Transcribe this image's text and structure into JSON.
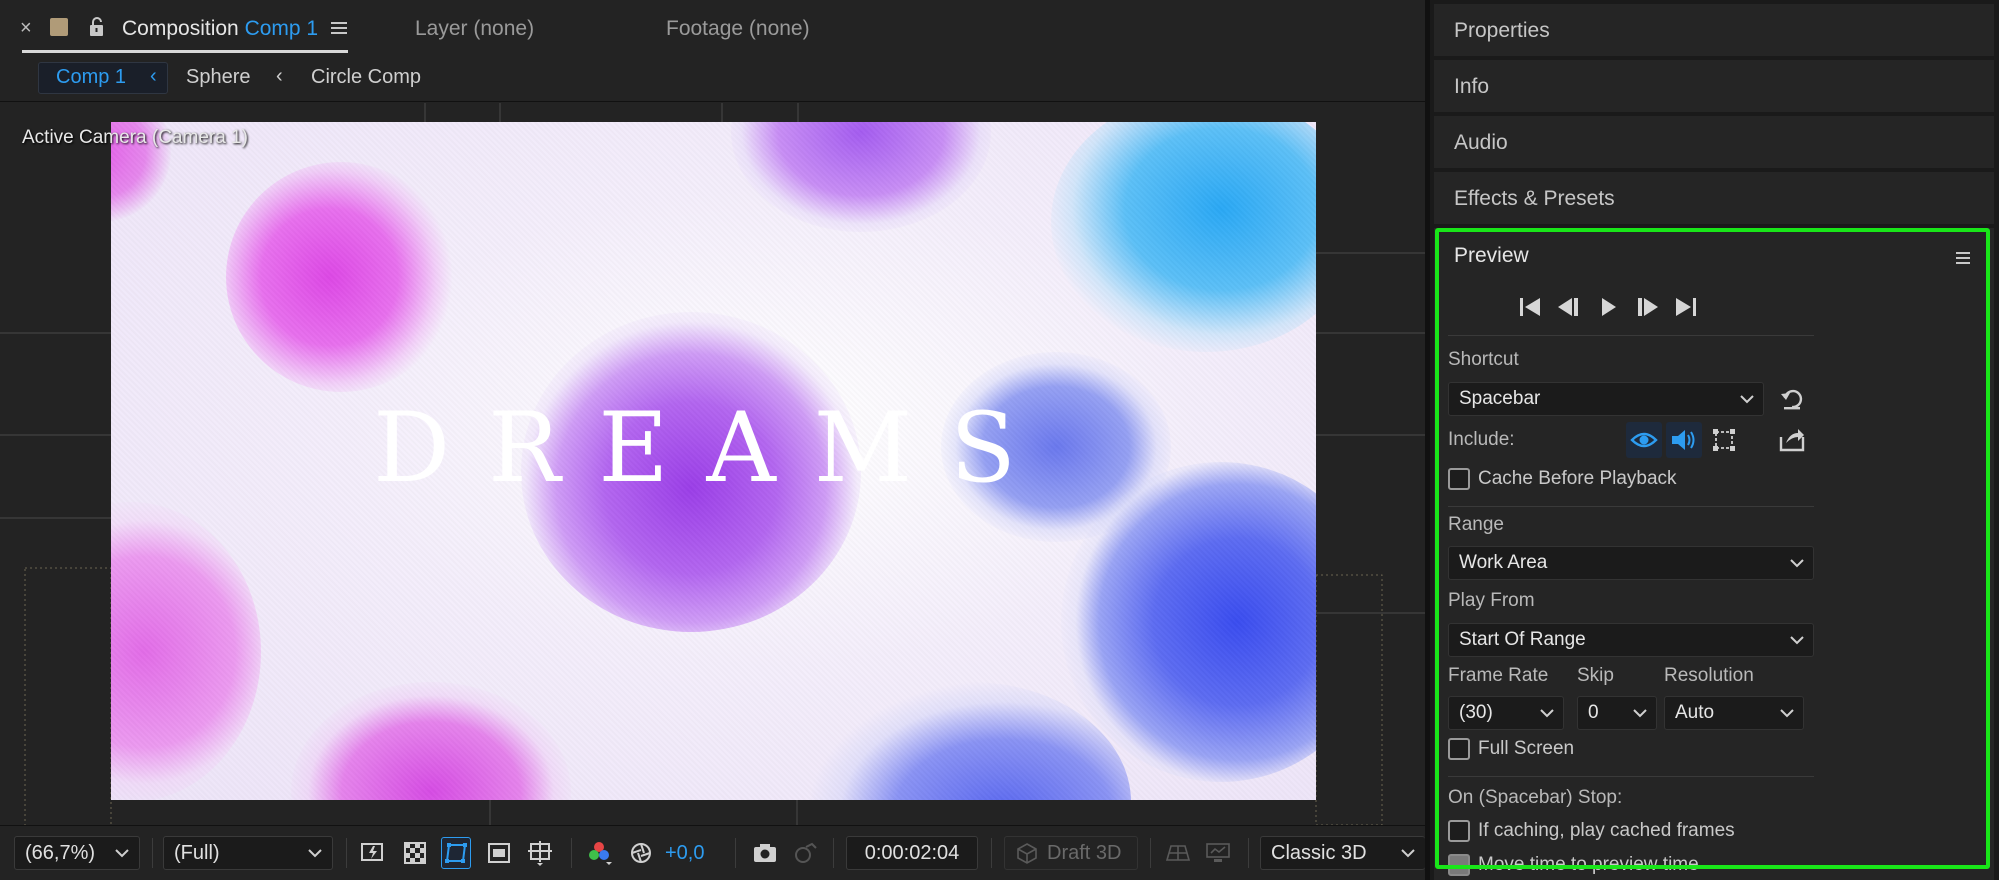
{
  "composition_panel": {
    "tabs": {
      "close_glyph": "×",
      "composition_label": "Composition",
      "composition_name": "Comp 1",
      "layer_label": "Layer (none)",
      "footage_label": "Footage (none)"
    },
    "breadcrumbs": [
      "Comp 1",
      "Sphere",
      "Circle Comp"
    ],
    "viewer": {
      "camera_label": "Active Camera (Camera 1)",
      "canvas_text": "DREAMS"
    },
    "bottom_bar": {
      "zoom": "(66,7%)",
      "resolution": "(Full)",
      "exposure": "+0,0",
      "timecode": "0:00:02:04",
      "draft_3d": "Draft 3D",
      "renderer": "Classic 3D"
    }
  },
  "right_panels": {
    "collapsed": [
      "Properties",
      "Info",
      "Audio",
      "Effects & Presets"
    ],
    "preview": {
      "title": "Preview",
      "shortcut_label": "Shortcut",
      "shortcut_value": "Spacebar",
      "include_label": "Include:",
      "cache_before_playback": "Cache Before Playback",
      "range_label": "Range",
      "range_value": "Work Area",
      "play_from_label": "Play From",
      "play_from_value": "Start Of Range",
      "frame_rate_label": "Frame Rate",
      "frame_rate_value": "(30)",
      "skip_label": "Skip",
      "skip_value": "0",
      "resolution_label": "Resolution",
      "resolution_value": "Auto",
      "full_screen": "Full Screen",
      "on_stop_label": "On (Spacebar) Stop:",
      "if_caching": "If caching, play cached frames",
      "move_time": "Move time to preview time"
    }
  },
  "colors": {
    "accent_blue": "#2d9cf0",
    "highlight_green": "#19e619",
    "panel_bg": "#252525"
  },
  "icons": [
    "close-icon",
    "lock-icon",
    "menu-icon",
    "chevron-left-icon",
    "first-frame-icon",
    "prev-frame-icon",
    "play-icon",
    "next-frame-icon",
    "last-frame-icon",
    "reset-icon",
    "eye-icon",
    "speaker-icon",
    "overlay-icon",
    "export-icon",
    "snapshot-icon",
    "color-icon",
    "exposure-icon"
  ]
}
